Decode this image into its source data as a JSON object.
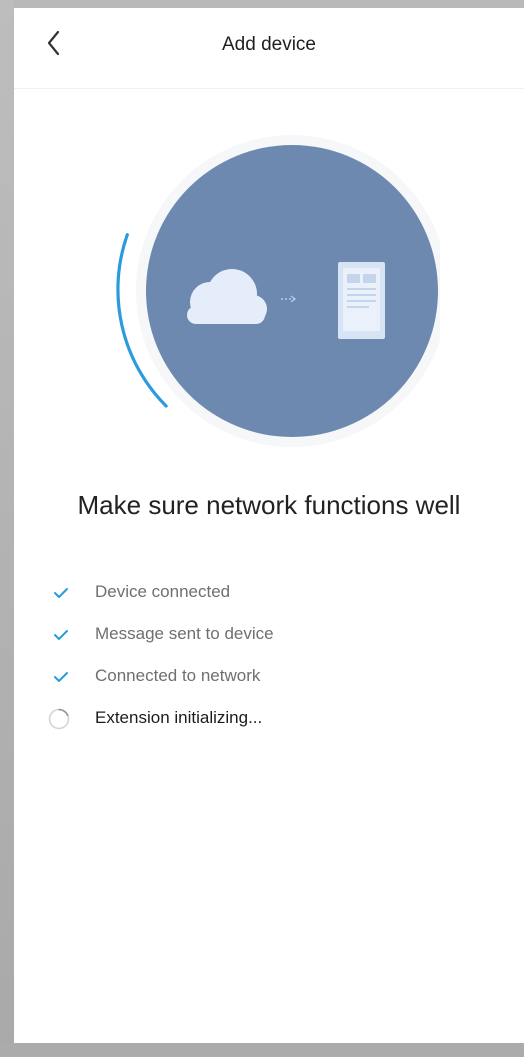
{
  "header": {
    "title": "Add device",
    "back_icon": "chevron-left-icon"
  },
  "illustration": {
    "cloud_icon": "cloud-icon",
    "arrow_icon": "arrow-right-icon",
    "device_icon": "phone-document-icon",
    "progress_ring_color": "#2a9bde",
    "circle_color": "#6d89b0"
  },
  "main": {
    "headline": "Make sure network functions well"
  },
  "steps": [
    {
      "label": "Device connected",
      "status": "done",
      "icon": "check-icon"
    },
    {
      "label": "Message sent to device",
      "status": "done",
      "icon": "check-icon"
    },
    {
      "label": "Connected to network",
      "status": "done",
      "icon": "check-icon"
    },
    {
      "label": "Extension initializing...",
      "status": "in-progress",
      "icon": "loading-spinner-icon"
    }
  ],
  "colors": {
    "accent": "#2a9bde",
    "background": "#ffffff"
  }
}
